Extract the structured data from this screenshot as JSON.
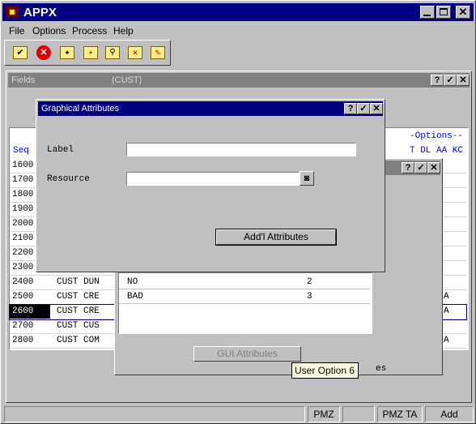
{
  "app": {
    "title": "APPX",
    "menu": [
      "File",
      "Options",
      "Process",
      "Help"
    ],
    "colors": {
      "title_active": "#000080",
      "title_inactive": "#808080",
      "blue_text": "#0000ff"
    }
  },
  "toolbar": {
    "icons": [
      "check-icon",
      "cancel-icon",
      "new-record-icon",
      "folder-add-icon",
      "search-icon",
      "folder-delete-icon",
      "folder-edit-icon"
    ]
  },
  "fields_window": {
    "title": "Fields",
    "subtitle": "(CUST)",
    "seq_header": "Seq",
    "options_header": "-Options--",
    "options_sub": "T DL AA KC",
    "rows": [
      {
        "seq": "1600",
        "name": "",
        "flag": ""
      },
      {
        "seq": "1700",
        "name": "",
        "flag": ""
      },
      {
        "seq": "1800",
        "name": "",
        "flag": ""
      },
      {
        "seq": "1900",
        "name": "",
        "flag": ""
      },
      {
        "seq": "2000",
        "name": "",
        "flag": ""
      },
      {
        "seq": "2100",
        "name": "",
        "flag": ""
      },
      {
        "seq": "2200",
        "name": "",
        "flag": ""
      },
      {
        "seq": "2300",
        "name": "",
        "flag": ""
      },
      {
        "seq": "2400",
        "name": "CUST DUN",
        "flag": ""
      },
      {
        "seq": "2500",
        "name": "CUST CRE",
        "flag": "A"
      },
      {
        "seq": "2600",
        "name": "CUST CRE",
        "flag": "A"
      },
      {
        "seq": "2700",
        "name": "CUST CUS",
        "flag": ""
      },
      {
        "seq": "2800",
        "name": "CUST COM",
        "flag": "A"
      }
    ]
  },
  "mid_window": {
    "list": [
      {
        "label": "NO",
        "value": "2"
      },
      {
        "label": "BAD",
        "value": "3"
      }
    ],
    "gui_attributes_button": "GUI Attributes",
    "trailing_text": "es"
  },
  "dialog": {
    "title": "Graphical Attributes",
    "label_caption": "Label",
    "label_value": "",
    "resource_caption": "Resource",
    "resource_value": "",
    "addl_button": "Add'l Attributes"
  },
  "tooltip": "User Option 6",
  "status_bar": [
    "",
    "PMZ",
    "",
    "PMZ TA",
    "Add"
  ]
}
